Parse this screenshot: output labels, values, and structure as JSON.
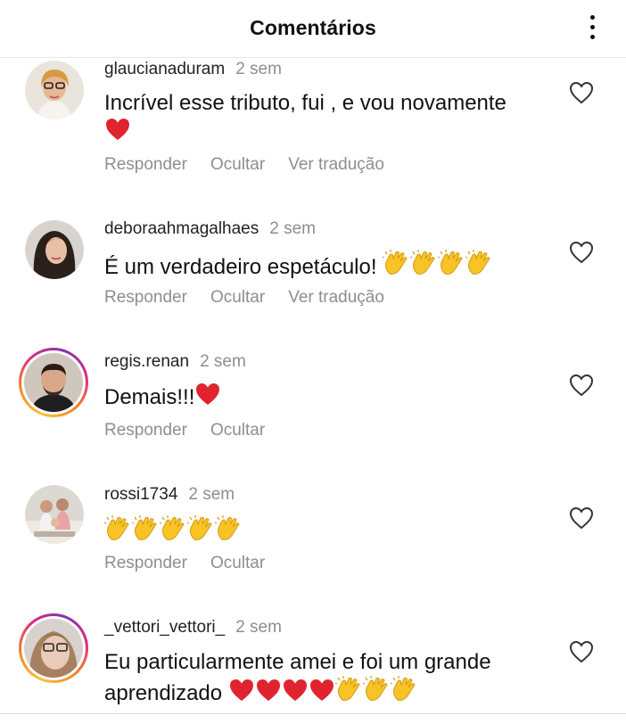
{
  "header": {
    "title": "Comentários",
    "menu_icon": "more-vertical-icon"
  },
  "comments": [
    {
      "username": "glaucianaduram",
      "time": "2 sem",
      "text": "Incrível esse tributo, fui , e vou novamente",
      "emojis": [
        "red-heart"
      ],
      "actions": [
        "Responder",
        "Ocultar",
        "Ver tradução"
      ],
      "ring": false
    },
    {
      "username": "deboraahmagalhaes",
      "time": "2 sem",
      "text": "É um verdadeiro espetáculo! ",
      "emojis": [
        "clapping-hands",
        "clapping-hands",
        "clapping-hands",
        "clapping-hands"
      ],
      "actions": [
        "Responder",
        "Ocultar",
        "Ver tradução"
      ],
      "ring": false
    },
    {
      "username": "regis.renan",
      "time": "2 sem",
      "text": "Demais!!!",
      "emojis": [
        "red-heart"
      ],
      "actions": [
        "Responder",
        "Ocultar"
      ],
      "ring": true
    },
    {
      "username": "rossi1734",
      "time": "2 sem",
      "text": "",
      "emojis": [
        "clapping-hands",
        "clapping-hands",
        "clapping-hands",
        "clapping-hands",
        "clapping-hands"
      ],
      "actions": [
        "Responder",
        "Ocultar"
      ],
      "ring": false
    },
    {
      "username": "_vettori_vettori_",
      "time": "2 sem",
      "text": "Eu particularmente amei e foi um grande aprendizado ",
      "emojis": [
        "red-heart",
        "red-heart",
        "red-heart",
        "red-heart",
        "clapping-hands",
        "clapping-hands",
        "clapping-hands"
      ],
      "actions": [],
      "ring": true
    }
  ],
  "colors": {
    "text": "#111111",
    "secondary": "#8e8e8e",
    "heart_emoji": "#e0242f",
    "clap_emoji": "#f7c325"
  }
}
